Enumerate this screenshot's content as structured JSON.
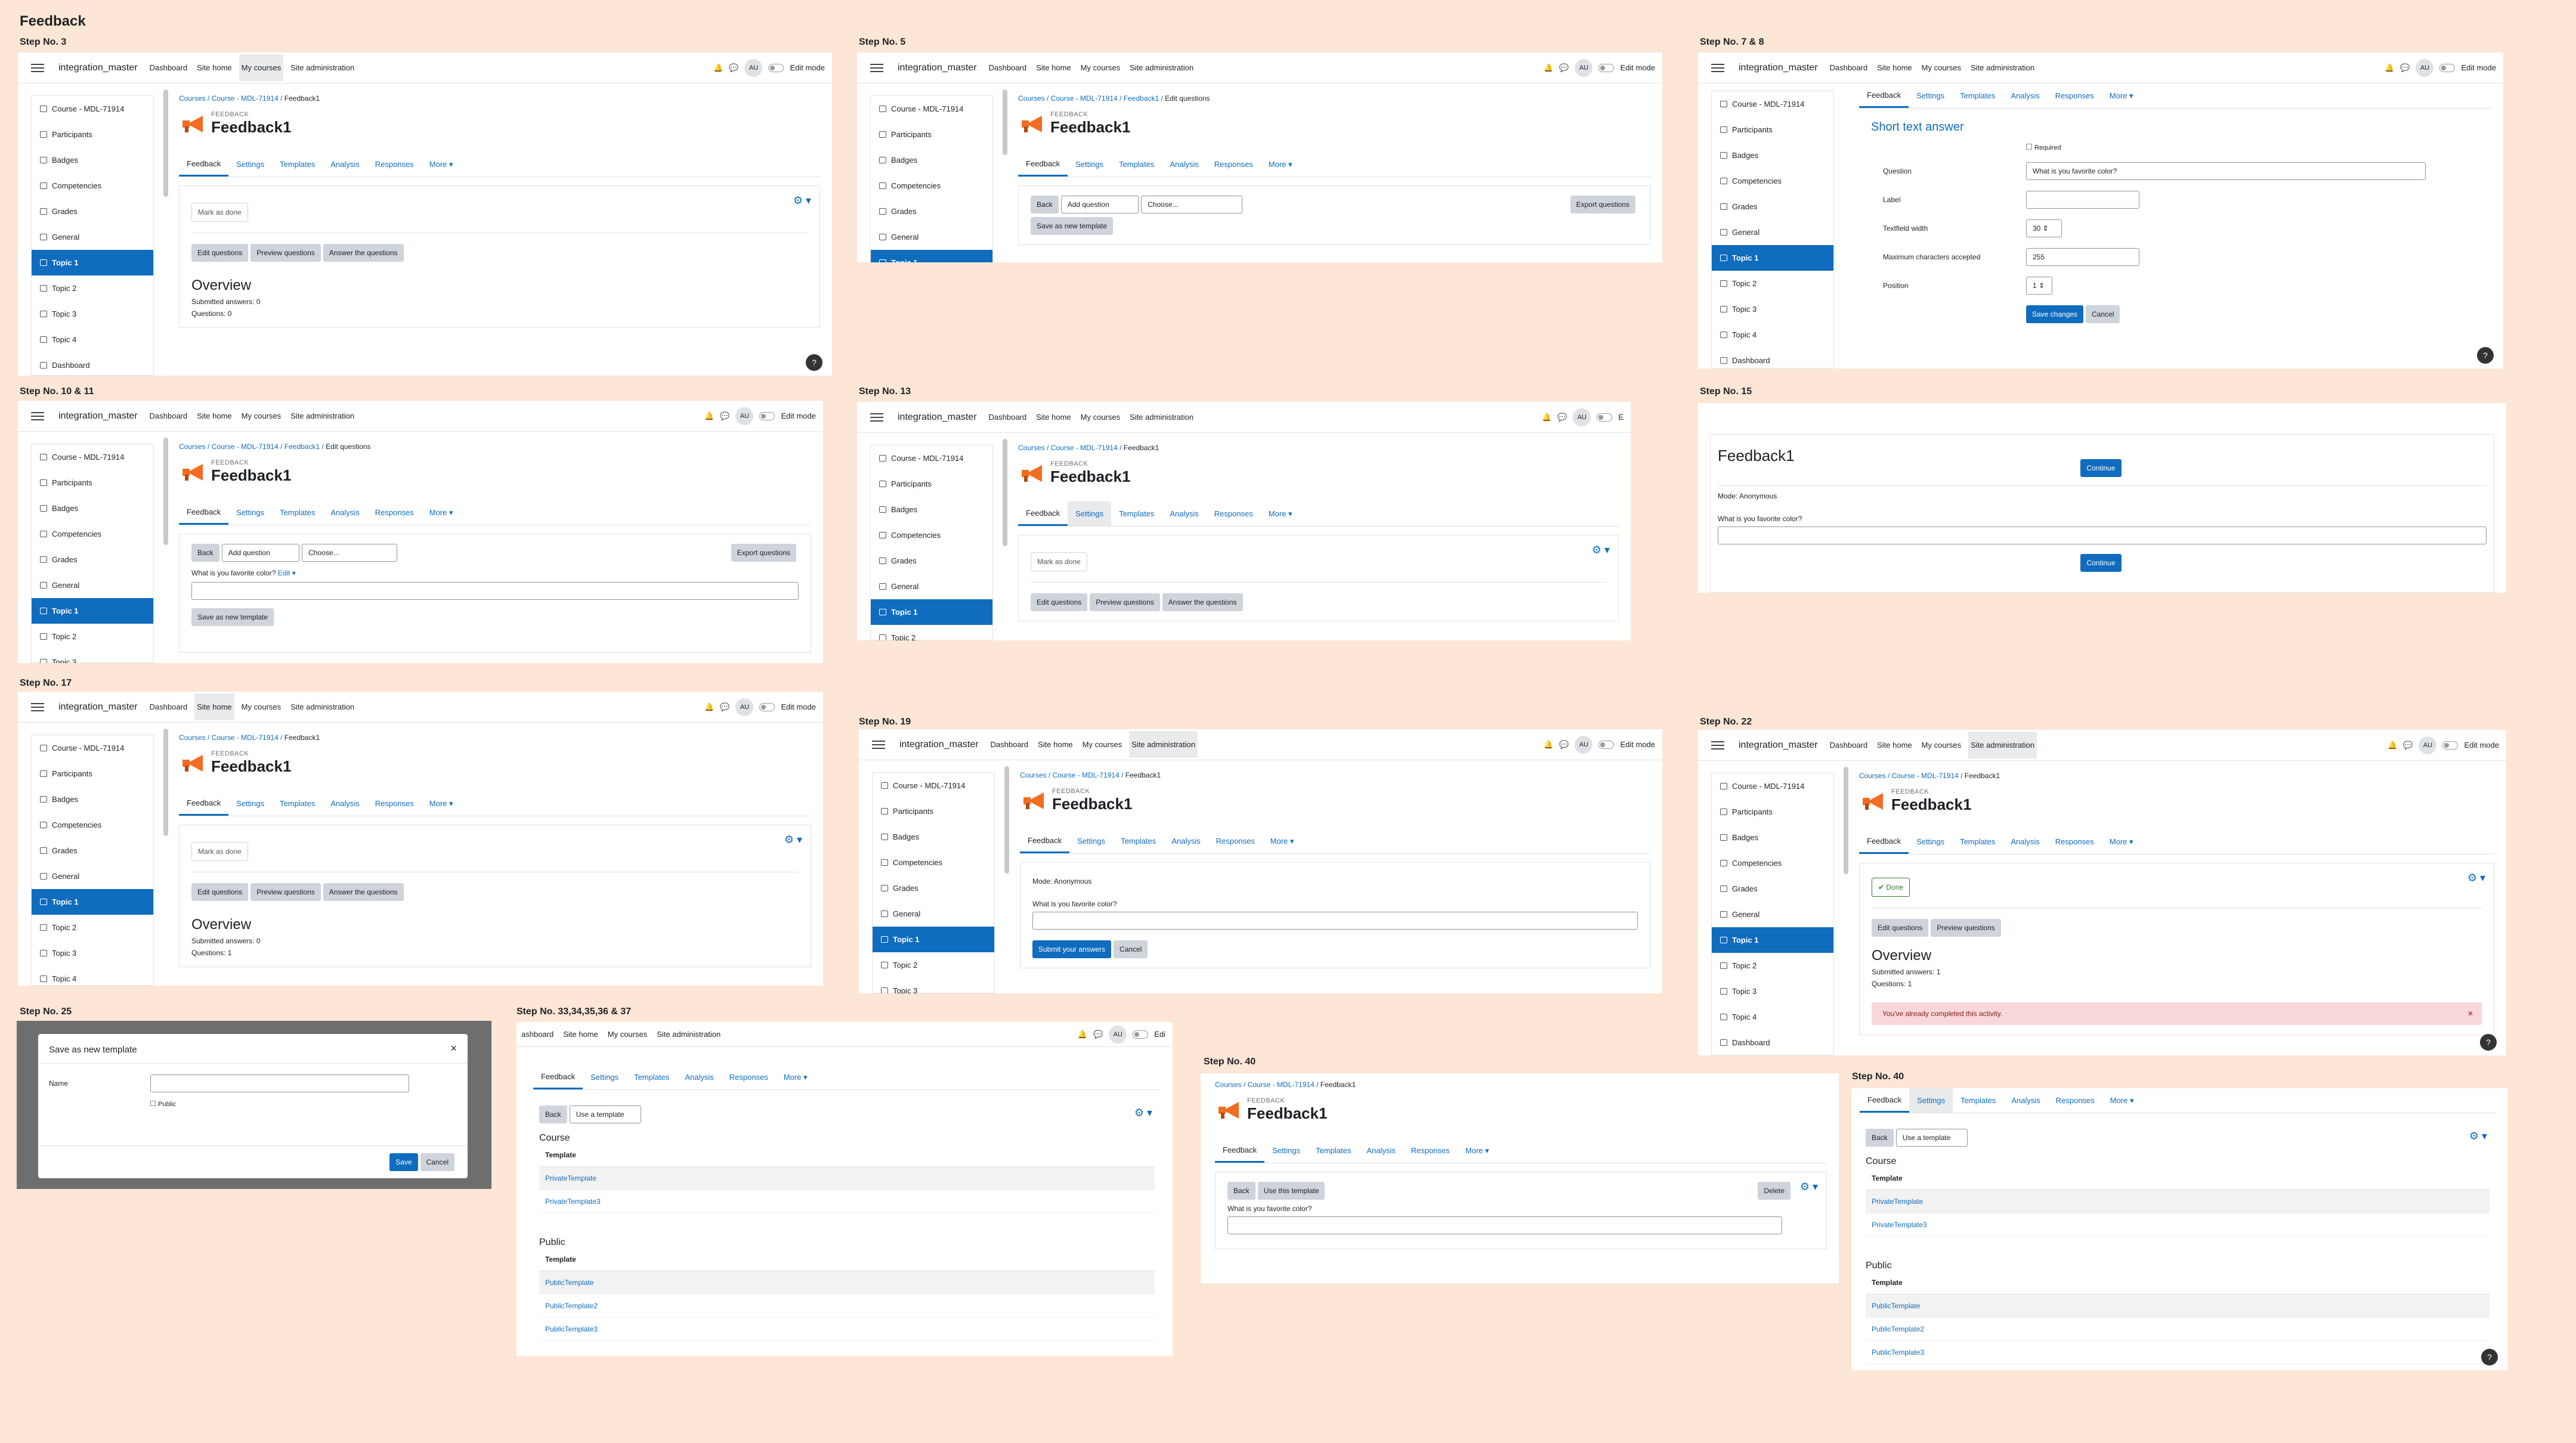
{
  "page_title": "Feedback",
  "steps": {
    "s1": "Step No. 3",
    "s2": "Step No. 5",
    "s3": "Step No. 7 & 8",
    "s4": "Step No. 10 & 11",
    "s5": "Step No. 13",
    "s6": "Step No. 15",
    "s7": "Step No. 17",
    "s8": "Step No. 19",
    "s9": "Step No. 22",
    "s10": "Step No. 25",
    "s11": "Step No. 33,34,35,36 & 37",
    "s12": "Step No. 40",
    "s13": "Step No. 40"
  },
  "nav": {
    "brand": "integration_master",
    "dashboard": "Dashboard",
    "site_home": "Site home",
    "my_courses": "My courses",
    "site_admin": "Site administration",
    "avatar": "AU",
    "edit_mode": "Edit mode",
    "edit_short": "E",
    "dashboard_cut": "ashboard",
    "edit_cut": "Edi"
  },
  "side": {
    "course": "Course - MDL-71914",
    "participants": "Participants",
    "badges": "Badges",
    "competencies": "Competencies",
    "grades": "Grades",
    "general": "General",
    "topic1": "Topic 1",
    "topic2": "Topic 2",
    "topic3": "Topic 3",
    "topic4": "Topic 4",
    "dashboard": "Dashboard"
  },
  "crumbs": {
    "courses": "Courses",
    "course": "Course - MDL-71914",
    "feedback": "Feedback1",
    "edit": "Edit questions",
    "sep": "/"
  },
  "activity": {
    "kind": "FEEDBACK",
    "name": "Feedback1"
  },
  "tabs": {
    "feedback": "Feedback",
    "settings": "Settings",
    "templates": "Templates",
    "analysis": "Analysis",
    "responses": "Responses",
    "more": "More ▾"
  },
  "buttons": {
    "mark_done": "Mark as done",
    "done": "✔ Done",
    "edit_q": "Edit questions",
    "preview_q": "Preview questions",
    "answer_q": "Answer the questions",
    "back": "Back",
    "add_q": "Add question",
    "choose": "Choose...",
    "export_q": "Export questions",
    "save_tpl": "Save as new template",
    "save_changes": "Save changes",
    "cancel": "Cancel",
    "continue": "Continue",
    "submit": "Submit your answers",
    "save": "Save",
    "use_tpl": "Use a template",
    "use_this": "Use this template",
    "delete": "Delete",
    "edit_link": "Edit ▾"
  },
  "overview": {
    "title": "Overview",
    "submitted0": "Submitted answers: 0",
    "questions0": "Questions: 0",
    "questions1": "Questions: 1",
    "submitted1": "Submitted answers: 1"
  },
  "form": {
    "section": "Short text answer",
    "required": "Required",
    "question": "Question",
    "question_val": "What is you favorite color?",
    "label": "Label",
    "width": "Textfield width",
    "width_val": "30 ⇕",
    "max": "Maximum characters accepted",
    "max_val": "255",
    "position": "Position",
    "position_val": "1 ⇕"
  },
  "answer": {
    "mode": "Mode: Anonymous",
    "question": "What is you favorite color?",
    "completed": "You've already completed this activity."
  },
  "modal": {
    "title": "Save as new template",
    "name": "Name",
    "public": "Public",
    "close": "×"
  },
  "templates": {
    "course": "Course",
    "public": "Public",
    "col": "Template",
    "c1": "PrivateTemplate",
    "c2": "PrivateTemplate3",
    "p1": "PublicTemplate",
    "p2": "PublicTemplate2",
    "p3": "PublicTemplate3"
  },
  "glyphs": {
    "gear": "⚙ ▾",
    "help": "?",
    "bell": "🔔",
    "chat": "💬",
    "caret": "▾",
    "x": "✕"
  }
}
